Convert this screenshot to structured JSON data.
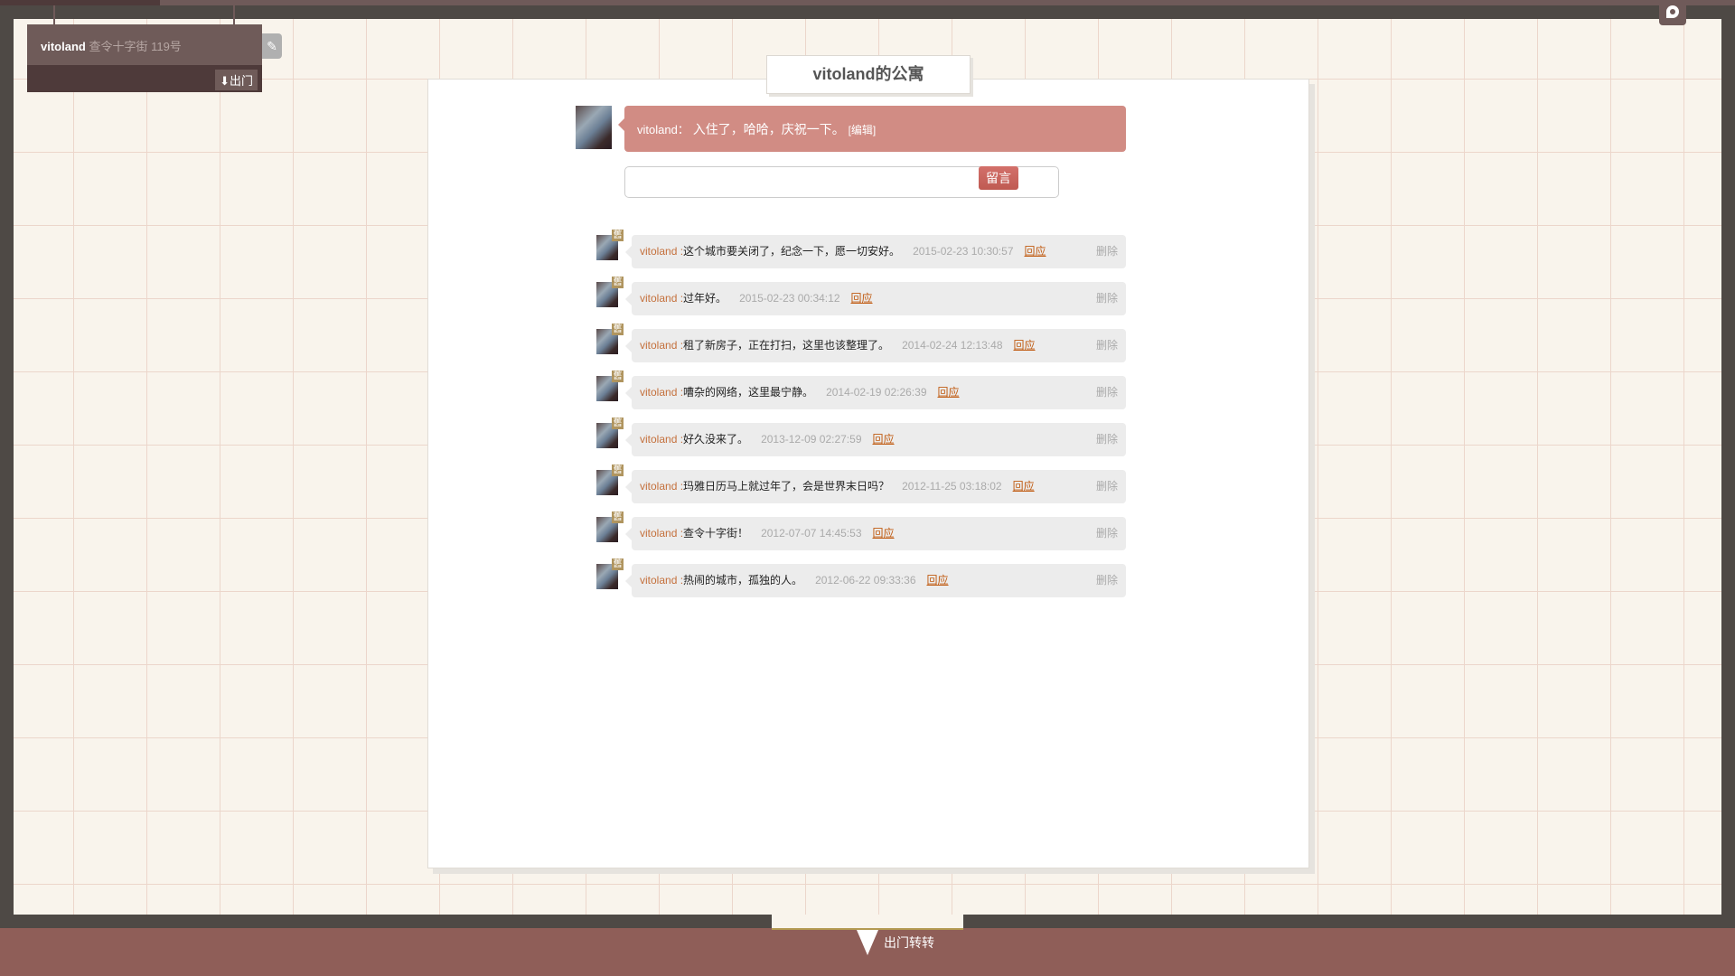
{
  "user_card": {
    "username": "vitoland",
    "address": "查令十字街 119号",
    "exit_label": "出门",
    "edit_icon": "pencil-icon"
  },
  "apartment_title": "vitoland的公寓",
  "status": {
    "user": "vitoland：",
    "text": "入住了，哈哈，庆祝一下。",
    "edit_label": "[编辑]"
  },
  "message_input": {
    "value": "",
    "placeholder": ""
  },
  "post_button": "留言",
  "comments": [
    {
      "badge": "舊",
      "user": "vitoland",
      ":": ":",
      "text": "这个城市要关闭了，纪念一下，愿一切安好。",
      "date": "2015-02-23 10:30:57",
      "reply": "回应",
      "delete": "删除"
    },
    {
      "badge": "舊",
      "user": "vitoland",
      "text": "过年好。",
      "date": "2015-02-23 00:34:12",
      "reply": "回应",
      "delete": "删除"
    },
    {
      "badge": "舊",
      "user": "vitoland",
      "text": "租了新房子，正在打扫，这里也该整理了。",
      "date": "2014-02-24 12:13:48",
      "reply": "回应",
      "delete": "删除"
    },
    {
      "badge": "舊",
      "user": "vitoland",
      "text": "嘈杂的网络，这里最宁静。",
      "date": "2014-02-19 02:26:39",
      "reply": "回应",
      "delete": "删除"
    },
    {
      "badge": "舊",
      "user": "vitoland",
      "text": "好久没来了。",
      "date": "2013-12-09 02:27:59",
      "reply": "回应",
      "delete": "删除"
    },
    {
      "badge": "舊",
      "user": "vitoland",
      "text": "玛雅日历马上就过年了，会是世界末日吗？",
      "date": "2012-11-25 03:18:02",
      "reply": "回应",
      "delete": "删除"
    },
    {
      "badge": "舊",
      "user": "vitoland",
      "text": "查令十字街！",
      "date": "2012-07-07 14:45:53",
      "reply": "回应",
      "delete": "删除"
    },
    {
      "badge": "舊",
      "user": "vitoland",
      "text": "热闹的城市，孤独的人。",
      "date": "2012-06-22 09:33:36",
      "reply": "回应",
      "delete": "删除"
    }
  ],
  "bottom_nav": {
    "label": "出门转转",
    "icon": "down-arrow-icon"
  },
  "colors": {
    "accent": "#d18c84",
    "button": "#c9625a",
    "bar": "#8f5e58",
    "frame": "#4e4945"
  }
}
